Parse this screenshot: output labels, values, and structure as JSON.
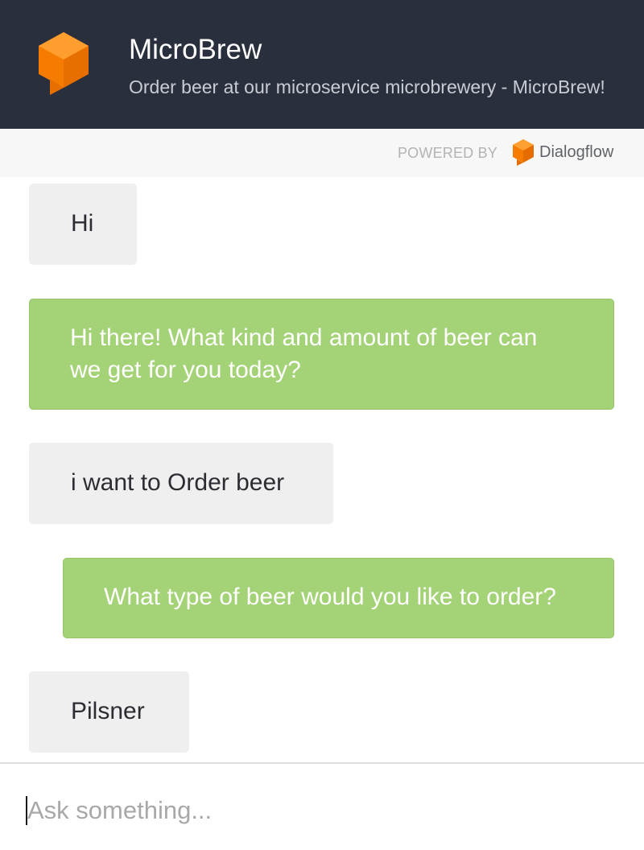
{
  "header": {
    "title": "MicroBrew",
    "subtitle": "Order beer at our microservice microbrewery - MicroBrew!",
    "logo_icon": "dialogflow-cube-bubble-icon",
    "background": "#2a2f3d"
  },
  "powered_by": {
    "label": "POWERED BY",
    "brand": "Dialogflow",
    "brand_icon": "dialogflow-icon",
    "accent": "#f57c00"
  },
  "messages": [
    {
      "role": "user",
      "text": "Hi"
    },
    {
      "role": "bot",
      "text": "Hi there! What kind and amount of beer can we get for you today?"
    },
    {
      "role": "user",
      "text": "i want to Order beer"
    },
    {
      "role": "bot",
      "text": "What type of beer would you like to order?"
    },
    {
      "role": "user",
      "text": "Pilsner"
    }
  ],
  "input": {
    "placeholder": "Ask something...",
    "value": ""
  },
  "colors": {
    "user_bubble": "#efefef",
    "bot_bubble": "#a4d276"
  }
}
